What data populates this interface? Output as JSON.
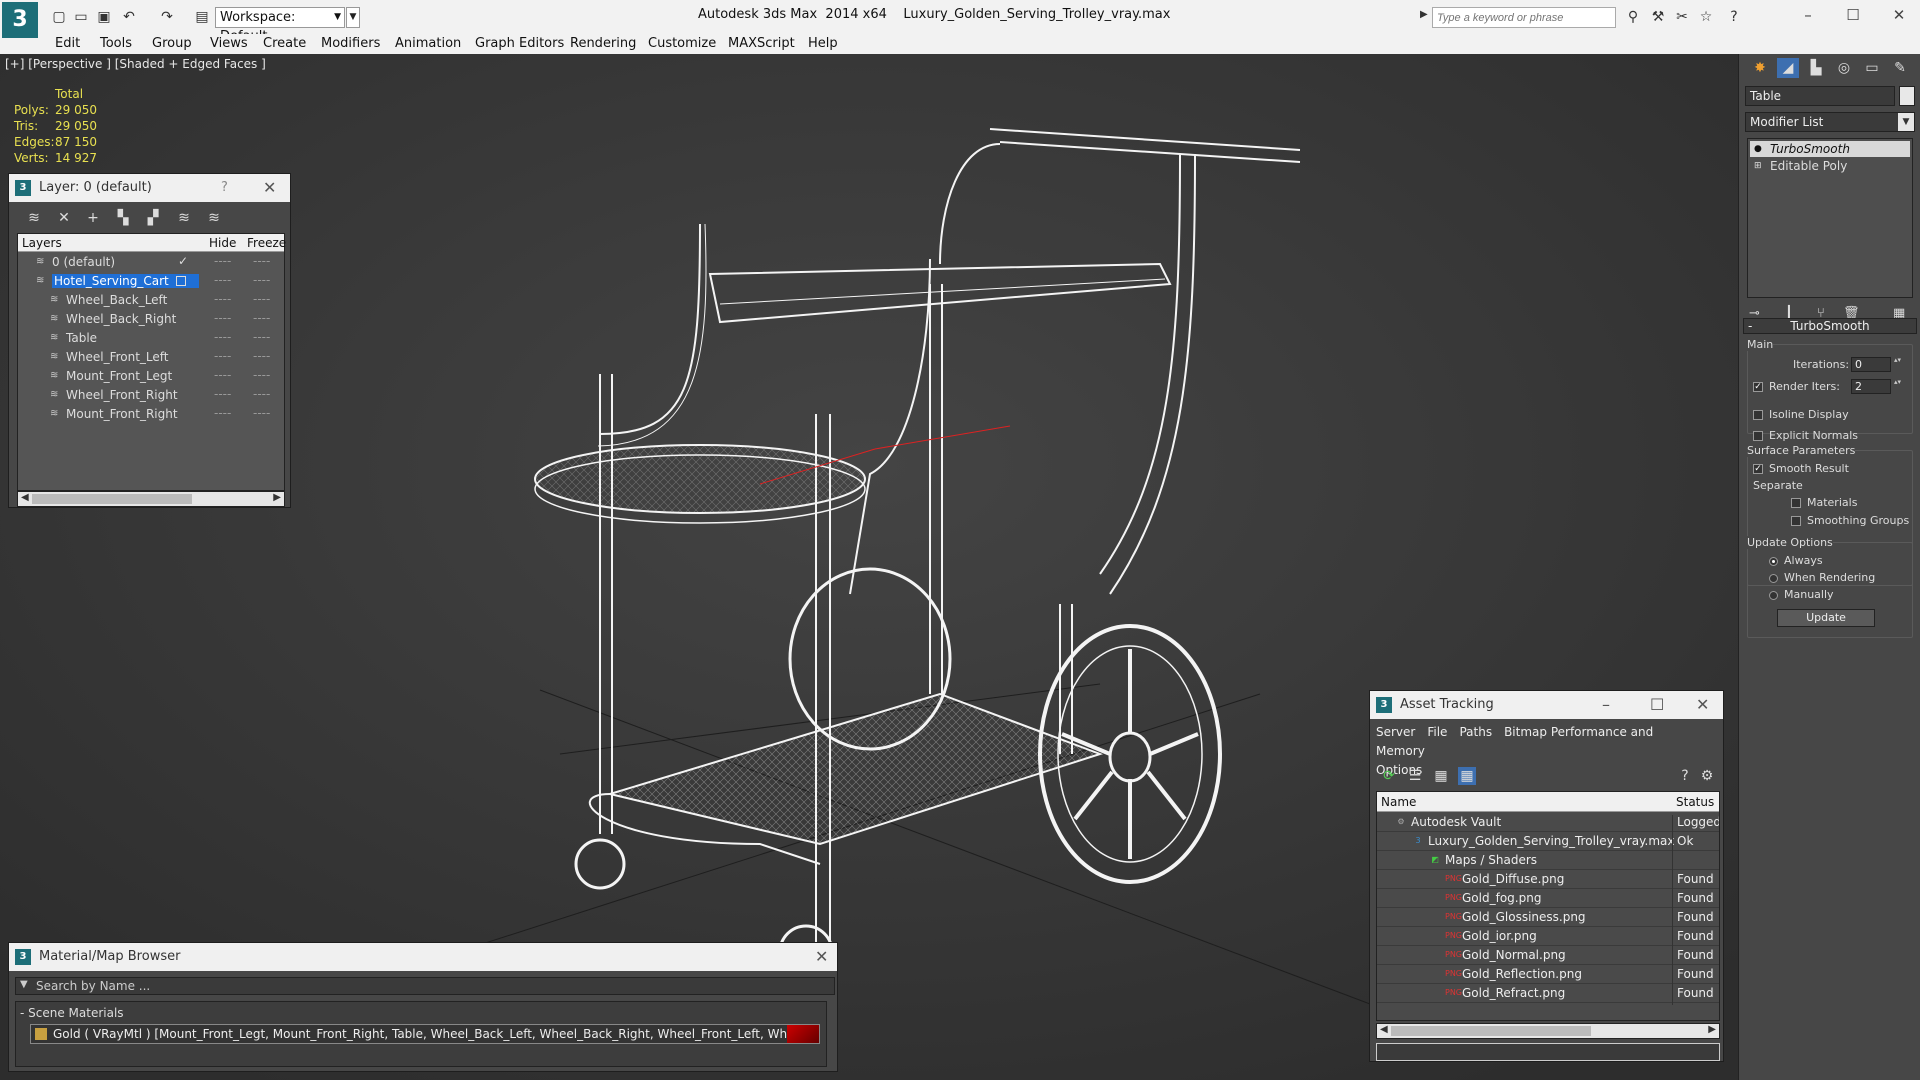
{
  "titlebar": {
    "workspace": "Workspace: Default",
    "app_name": "Autodesk 3ds Max  2014 x64",
    "file_name": "Luxury_Golden_Serving_Trolley_vray.max",
    "search_placeholder": "Type a keyword or phrase"
  },
  "menu": [
    "Edit",
    "Tools",
    "Group",
    "Views",
    "Create",
    "Modifiers",
    "Animation",
    "Graph Editors",
    "Rendering",
    "Customize",
    "MAXScript",
    "Help"
  ],
  "viewport": {
    "label": "[+] [Perspective ] [Shaded + Edged Faces ]",
    "stats": {
      "header": "Total",
      "rows": [
        {
          "key": "Polys:",
          "value": "29 050"
        },
        {
          "key": "Tris:",
          "value": "29 050"
        },
        {
          "key": "Edges:",
          "value": "87 150"
        },
        {
          "key": "Verts:",
          "value": "14 927"
        }
      ]
    }
  },
  "layer_panel": {
    "title": "Layer: 0 (default)",
    "help": "?",
    "columns": {
      "layers": "Layers",
      "hide": "Hide",
      "freeze": "Freeze"
    },
    "rows": [
      {
        "name": "0 (default)",
        "level": 0,
        "checked": true
      },
      {
        "name": "Hotel_Serving_Cart",
        "level": 0,
        "selected": true
      },
      {
        "name": "Wheel_Back_Left",
        "level": 1
      },
      {
        "name": "Wheel_Back_Right",
        "level": 1
      },
      {
        "name": "Table",
        "level": 1
      },
      {
        "name": "Wheel_Front_Left",
        "level": 1
      },
      {
        "name": "Mount_Front_Legt",
        "level": 1
      },
      {
        "name": "Wheel_Front_Right",
        "level": 1
      },
      {
        "name": "Mount_Front_Right",
        "level": 1
      }
    ],
    "dash": "----"
  },
  "material_browser": {
    "title": "Material/Map Browser",
    "search_placeholder": "Search by Name ...",
    "section": "- Scene Materials",
    "material": "Gold  ( VRayMtl )  [Mount_Front_Legt, Mount_Front_Right, Table, Wheel_Back_Left, Wheel_Back_Right, Wheel_Front_Left, Wheel_Front_Right]"
  },
  "asset_tracking": {
    "title": "Asset Tracking",
    "menu": [
      "Server",
      "File",
      "Paths",
      "Bitmap Performance and Memory",
      "Options"
    ],
    "columns": {
      "name": "Name",
      "status": "Status"
    },
    "rows": [
      {
        "name": "Autodesk Vault",
        "status": "Logged O",
        "level": 1,
        "icon": "vault"
      },
      {
        "name": "Luxury_Golden_Serving_Trolley_vray.max",
        "status": "Ok",
        "level": 2,
        "icon": "max"
      },
      {
        "name": "Maps / Shaders",
        "status": "",
        "level": 3,
        "icon": "maps"
      },
      {
        "name": "Gold_Diffuse.png",
        "status": "Found",
        "level": 4,
        "icon": "png"
      },
      {
        "name": "Gold_fog.png",
        "status": "Found",
        "level": 4,
        "icon": "png"
      },
      {
        "name": "Gold_Glossiness.png",
        "status": "Found",
        "level": 4,
        "icon": "png"
      },
      {
        "name": "Gold_ior.png",
        "status": "Found",
        "level": 4,
        "icon": "png"
      },
      {
        "name": "Gold_Normal.png",
        "status": "Found",
        "level": 4,
        "icon": "png"
      },
      {
        "name": "Gold_Reflection.png",
        "status": "Found",
        "level": 4,
        "icon": "png"
      },
      {
        "name": "Gold_Refract.png",
        "status": "Found",
        "level": 4,
        "icon": "png"
      }
    ]
  },
  "command_panel": {
    "object_name": "Table",
    "modifier_list": "Modifier List",
    "stack": [
      "TurboSmooth",
      "Editable Poly"
    ],
    "rollout_title": "TurboSmooth",
    "main_label": "Main",
    "iterations_label": "Iterations:",
    "iterations_value": "0",
    "render_iters_label": "Render Iters:",
    "render_iters_value": "2",
    "isoline_label": "Isoline Display",
    "explicit_normals_label": "Explicit Normals",
    "surface_label": "Surface Parameters",
    "smooth_result_label": "Smooth Result",
    "separate_label": "Separate",
    "materials_label": "Materials",
    "smoothing_groups_label": "Smoothing Groups",
    "update_options_label": "Update Options",
    "always_label": "Always",
    "when_rendering_label": "When Rendering",
    "manually_label": "Manually",
    "update_button": "Update"
  }
}
